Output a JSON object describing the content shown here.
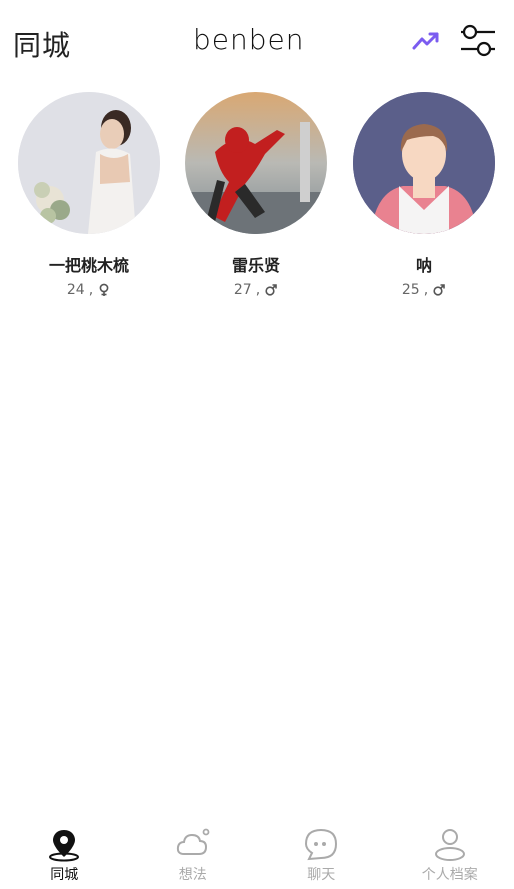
{
  "header": {
    "title": "同城",
    "logo": "benben"
  },
  "users": [
    {
      "name": "一把桃木梳",
      "age": "24",
      "gender": "female",
      "separator": ","
    },
    {
      "name": "雷乐贤",
      "age": "27",
      "gender": "male",
      "separator": ","
    },
    {
      "name": "呐",
      "age": "25",
      "gender": "male",
      "separator": ","
    }
  ],
  "tabs": [
    {
      "label": "同城",
      "icon": "location-pin-icon",
      "active": true
    },
    {
      "label": "想法",
      "icon": "cloud-icon",
      "active": false
    },
    {
      "label": "聊天",
      "icon": "chat-bubble-icon",
      "active": false
    },
    {
      "label": "个人档案",
      "icon": "person-icon",
      "active": false
    }
  ],
  "colors": {
    "accent": "#7b5cf0",
    "active_tab": "#111111",
    "inactive_tab": "#aaaaaa"
  }
}
